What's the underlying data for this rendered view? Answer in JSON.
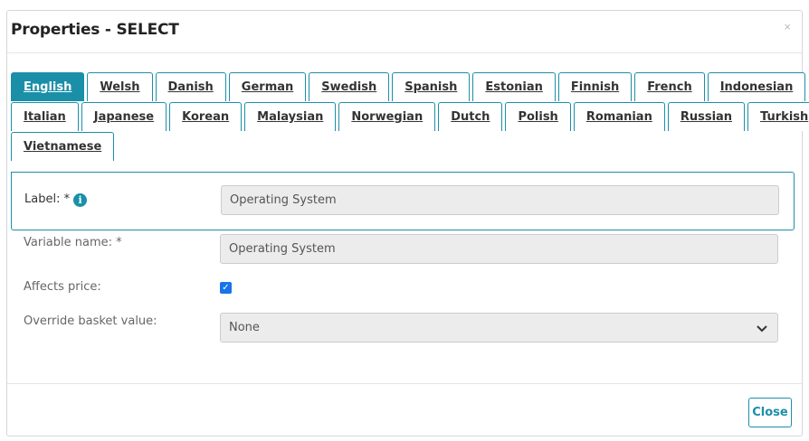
{
  "dialog": {
    "title": "Properties - SELECT",
    "close_x": "×"
  },
  "tabs": {
    "row1": [
      "English",
      "Welsh",
      "Danish",
      "German",
      "Swedish",
      "Spanish",
      "Estonian",
      "Finnish",
      "French",
      "Indonesian"
    ],
    "row2": [
      "Italian",
      "Japanese",
      "Korean",
      "Malaysian",
      "Norwegian",
      "Dutch",
      "Polish",
      "Romanian",
      "Russian",
      "Turkish"
    ],
    "row3": [
      "Vietnamese"
    ],
    "active": "English"
  },
  "fields": {
    "label": {
      "label": "Label: *",
      "value": "Operating System",
      "icon": "info-icon"
    },
    "variable_name": {
      "label": "Variable name: *",
      "value": "Operating System"
    },
    "affects_price": {
      "label": "Affects price:",
      "checked": true
    },
    "override_basket": {
      "label": "Override basket value:",
      "value": "None"
    }
  },
  "footer": {
    "close_label": "Close"
  },
  "colors": {
    "accent": "#1b8fa8",
    "checkbox": "#1a73e8"
  }
}
